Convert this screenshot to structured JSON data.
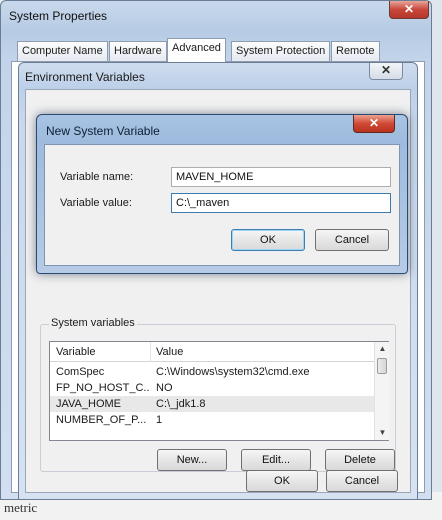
{
  "system_properties": {
    "title": "System Properties",
    "close_glyph": "✕",
    "tabs": [
      {
        "label": "Computer Name"
      },
      {
        "label": "Hardware"
      },
      {
        "label": "Advanced",
        "active": true
      },
      {
        "label": "System Protection"
      },
      {
        "label": "Remote"
      }
    ]
  },
  "environment_variables": {
    "title": "Environment Variables",
    "close_glyph": "✕",
    "system_variables": {
      "label": "System variables",
      "columns": [
        "Variable",
        "Value"
      ],
      "rows": [
        {
          "variable": "ComSpec",
          "value": "C:\\Windows\\system32\\cmd.exe"
        },
        {
          "variable": "FP_NO_HOST_C...",
          "value": "NO"
        },
        {
          "variable": "JAVA_HOME",
          "value": "C:\\_jdk1.8",
          "selected": true
        },
        {
          "variable": "NUMBER_OF_P...",
          "value": "1"
        }
      ],
      "buttons": {
        "new": "New...",
        "edit": "Edit...",
        "delete": "Delete"
      }
    },
    "buttons": {
      "ok": "OK",
      "cancel": "Cancel"
    }
  },
  "new_system_variable": {
    "title": "New System Variable",
    "close_glyph": "✕",
    "name_label": "Variable name:",
    "name_value": "MAVEN_HOME",
    "value_label": "Variable value:",
    "value_value": "C:\\_maven",
    "ok": "OK",
    "cancel": "Cancel"
  },
  "background": {
    "bottom_text": "metric"
  },
  "colors": {
    "accent_focus": "#3d7bad",
    "close_red": "#c8473a"
  }
}
